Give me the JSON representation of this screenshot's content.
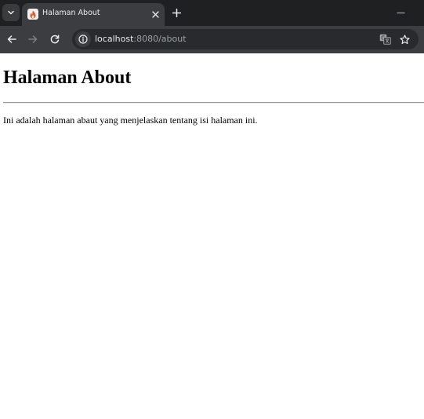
{
  "browser": {
    "tab": {
      "title": "Halaman About",
      "favicon_icon": "flame-icon"
    },
    "address_bar": {
      "url_host": "localhost",
      "url_rest": ":8080/about"
    },
    "icons": {
      "tab_search": "chevron-down-icon",
      "close_tab": "close-icon",
      "new_tab": "plus-icon",
      "minimize": "minimize-icon",
      "back": "arrow-left-icon",
      "forward": "arrow-right-icon",
      "reload": "reload-icon",
      "site_info": "info-icon",
      "translate": "translate-icon",
      "bookmark": "star-icon"
    },
    "colors": {
      "frame": "#1f2022",
      "toolbar": "#3c3d40",
      "omnibox": "#282a2d",
      "favicon_flame": "#e8572a"
    }
  },
  "page": {
    "heading": "Halaman About",
    "paragraph": "Ini adalah halaman abaut yang menjelaskan tentang isi halaman ini."
  }
}
